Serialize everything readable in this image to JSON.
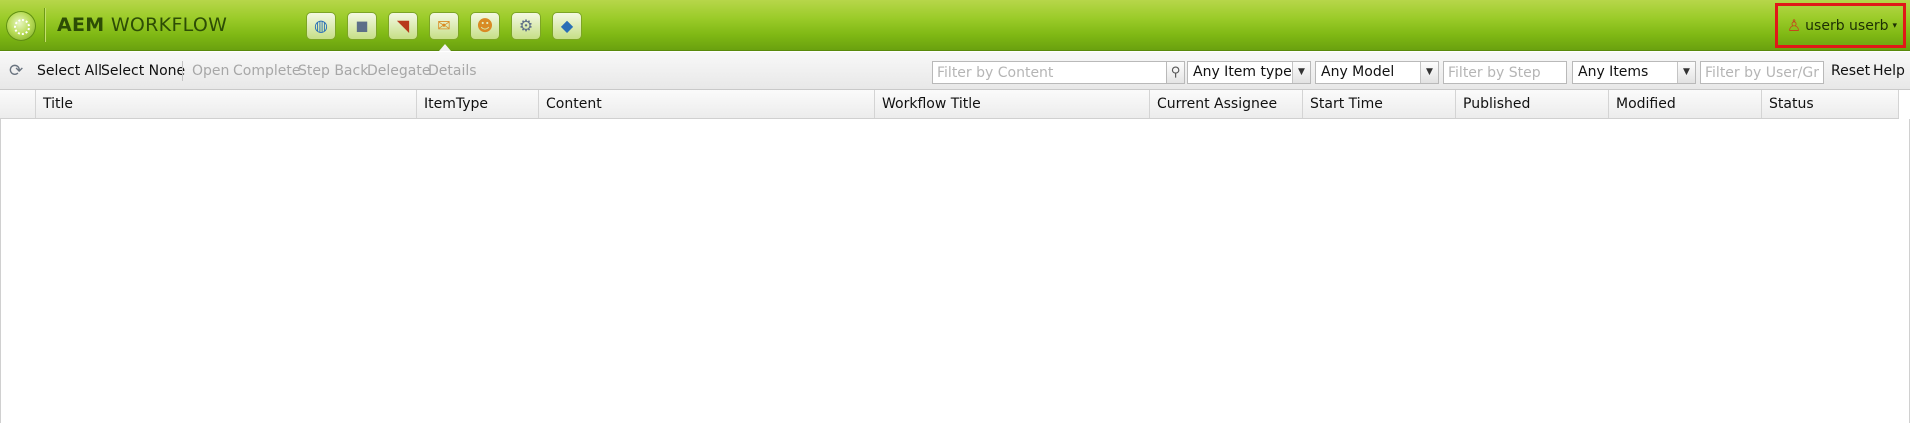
{
  "header": {
    "title_bold": "AEM",
    "title_rest": "WORKFLOW",
    "nav_icons": [
      {
        "name": "globe-icon",
        "glyph": "◍"
      },
      {
        "name": "camera-icon",
        "glyph": "◼"
      },
      {
        "name": "megaphone-icon",
        "glyph": "◥"
      },
      {
        "name": "inbox-envelope-icon",
        "glyph": "✉"
      },
      {
        "name": "users-icon",
        "glyph": "☻"
      },
      {
        "name": "tools-icon",
        "glyph": "⚙"
      },
      {
        "name": "tag-icon",
        "glyph": "◆"
      }
    ],
    "user_name": "userb userb",
    "user_caret": "▾"
  },
  "toolbar": {
    "refresh_glyph": "⟳",
    "select_all": "Select All",
    "select_none": "Select None",
    "open": "Open",
    "complete": "Complete",
    "step_back": "Step Back",
    "delegate": "Delegate",
    "details": "Details",
    "filter_content_placeholder": "Filter by Content",
    "search_glyph": "⚲",
    "item_type_value": "Any Item type",
    "model_value": "Any Model",
    "filter_step_placeholder": "Filter by Step",
    "items_value": "Any Items",
    "filter_user_placeholder": "Filter by User/Gro",
    "reset": "Reset",
    "help": "Help",
    "arrow": "▼"
  },
  "grid": {
    "columns": [
      "Title",
      "ItemType",
      "Content",
      "Workflow Title",
      "Current Assignee",
      "Start Time",
      "Published",
      "Modified",
      "Status"
    ]
  },
  "colors": {
    "header_green": "#8cc21c",
    "highlight_red": "#e01818"
  }
}
